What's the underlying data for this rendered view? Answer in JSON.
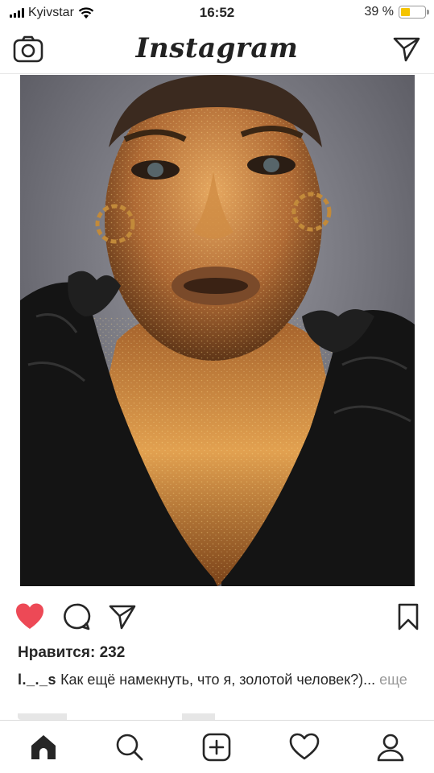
{
  "status_bar": {
    "carrier": "Kyivstar",
    "time": "16:52",
    "battery": "39 %",
    "battery_level": 0.39
  },
  "header": {
    "logo": "Instagram",
    "camera_icon": "camera-icon",
    "send_icon": "paper-plane-icon"
  },
  "post": {
    "likes_text": "Нравится: 232",
    "username": "l._._s",
    "caption": "Как ещё намекнуть, что я, золотой человек?)...",
    "more_label": "еще"
  },
  "actions": {
    "like_icon": "heart-filled-icon",
    "comment_icon": "comment-bubble-icon",
    "share_icon": "paper-plane-icon",
    "save_icon": "bookmark-icon",
    "like_color": "#ed4956"
  },
  "bottom_nav": {
    "items": [
      "home-icon",
      "search-icon",
      "add-post-icon",
      "activity-heart-icon",
      "profile-icon"
    ]
  }
}
